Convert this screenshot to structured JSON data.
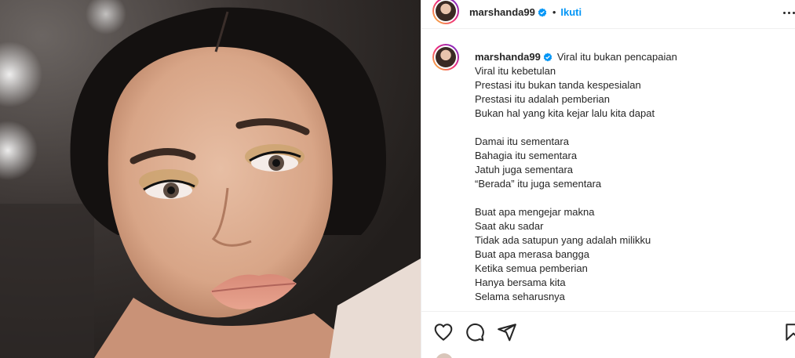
{
  "post": {
    "username": "marshanda99",
    "follow_label": "Ikuti",
    "separator": "•"
  },
  "caption": {
    "username": "marshanda99",
    "first_line": "Viral itu bukan pencapaian",
    "lines": [
      "Viral itu kebetulan",
      "Prestasi itu bukan tanda kespesialan",
      "Prestasi itu adalah pemberian",
      "Bukan hal yang kita kejar lalu kita dapat",
      "",
      "Damai itu sementara",
      "Bahagia itu sementara",
      "Jatuh juga sementara",
      "“Berada” itu juga sementara",
      "",
      "Buat apa mengejar makna",
      "Saat aku sadar",
      "Tidak ada satupun yang adalah milikku",
      "Buat apa merasa bangga",
      "Ketika semua pemberian",
      "Hanya bersama kita",
      "Selama seharusnya"
    ]
  },
  "icons": {
    "verified": "verified-badge-icon",
    "more": "more-options-icon",
    "like": "heart-icon",
    "comment": "comment-icon",
    "share": "paper-plane-icon",
    "save": "bookmark-icon"
  },
  "colors": {
    "accent": "#0095f6",
    "text": "#262626",
    "divider": "#efefef"
  }
}
